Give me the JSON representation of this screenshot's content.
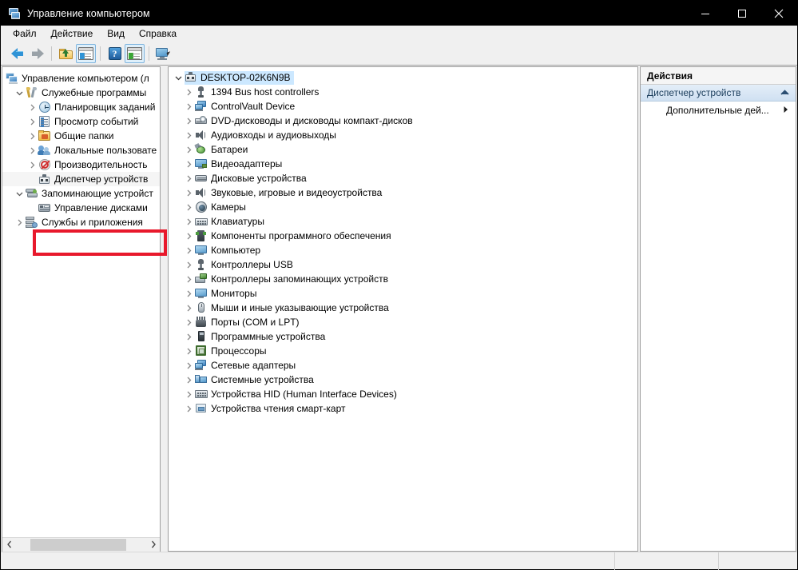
{
  "window": {
    "title": "Управление компьютером",
    "icon": "computer-management-icon",
    "minimize_label": "—",
    "maximize_label": "▢",
    "close_label": "✕"
  },
  "menubar": {
    "items": [
      {
        "label": "Файл",
        "name": "menu-file"
      },
      {
        "label": "Действие",
        "name": "menu-action"
      },
      {
        "label": "Вид",
        "name": "menu-view"
      },
      {
        "label": "Справка",
        "name": "menu-help"
      }
    ]
  },
  "toolbar": {
    "buttons": [
      {
        "name": "back-button",
        "icon": "back-arrow-icon"
      },
      {
        "name": "forward-button",
        "icon": "forward-arrow-icon"
      },
      {
        "name": "up-one-level-button",
        "icon": "folder-up-icon"
      },
      {
        "name": "show-hide-console-tree-button",
        "icon": "tree-panel-icon"
      },
      {
        "name": "help-button",
        "icon": "help-icon"
      },
      {
        "name": "show-hide-action-pane-button",
        "icon": "action-pane-icon"
      },
      {
        "name": "properties-button",
        "icon": "console-display-icon"
      }
    ]
  },
  "tree": {
    "items": [
      {
        "label": "Управление компьютером (л",
        "icon": "console-icon",
        "indent": 0,
        "chevron": "none",
        "name": "tree-item-computer-management"
      },
      {
        "label": "Служебные программы",
        "icon": "tools-icon",
        "indent": 1,
        "chevron": "expanded",
        "name": "tree-item-system-tools"
      },
      {
        "label": "Планировщик заданий",
        "icon": "clock-icon",
        "indent": 2,
        "chevron": "collapsed",
        "name": "tree-item-task-scheduler"
      },
      {
        "label": "Просмотр событий",
        "icon": "event-viewer-icon",
        "indent": 2,
        "chevron": "collapsed",
        "name": "tree-item-event-viewer"
      },
      {
        "label": "Общие папки",
        "icon": "shared-folders-icon",
        "indent": 2,
        "chevron": "collapsed",
        "name": "tree-item-shared-folders"
      },
      {
        "label": "Локальные пользовате",
        "icon": "users-icon",
        "indent": 2,
        "chevron": "collapsed",
        "name": "tree-item-local-users-groups"
      },
      {
        "label": "Производительность",
        "icon": "performance-icon",
        "indent": 2,
        "chevron": "collapsed",
        "name": "tree-item-performance"
      },
      {
        "label": "Диспетчер устройств",
        "icon": "device-manager-icon",
        "indent": 2,
        "chevron": "none",
        "name": "tree-item-device-manager",
        "selected": true
      },
      {
        "label": "Запоминающие устройст",
        "icon": "storage-icon",
        "indent": 1,
        "chevron": "expanded",
        "name": "tree-item-storage"
      },
      {
        "label": "Управление дисками",
        "icon": "disk-management-icon",
        "indent": 2,
        "chevron": "none",
        "name": "tree-item-disk-management"
      },
      {
        "label": "Службы и приложения",
        "icon": "services-icon",
        "indent": 1,
        "chevron": "collapsed",
        "name": "tree-item-services-applications"
      }
    ],
    "hscroll": {
      "left_arrow": "‹",
      "right_arrow": "›"
    }
  },
  "device_list": {
    "root": {
      "label": "DESKTOP-02K6N9B",
      "icon": "computer-node-icon",
      "chevron": "expanded",
      "selected": true
    },
    "items": [
      {
        "label": "1394 Bus host controllers",
        "icon": "usb-icon"
      },
      {
        "label": "ControlVault Device",
        "icon": "network-device-icon"
      },
      {
        "label": "DVD-дисководы и дисководы компакт-дисков",
        "icon": "dvd-drive-icon"
      },
      {
        "label": "Аудиовходы и аудиовыходы",
        "icon": "speaker-icon"
      },
      {
        "label": "Батареи",
        "icon": "battery-icon"
      },
      {
        "label": "Видеоадаптеры",
        "icon": "video-adapter-icon"
      },
      {
        "label": "Дисковые устройства",
        "icon": "hard-disk-icon"
      },
      {
        "label": "Звуковые, игровые и видеоустройства",
        "icon": "speaker-icon"
      },
      {
        "label": "Камеры",
        "icon": "camera-icon"
      },
      {
        "label": "Клавиатуры",
        "icon": "keyboard-icon"
      },
      {
        "label": "Компоненты программного обеспечения",
        "icon": "software-component-icon"
      },
      {
        "label": "Компьютер",
        "icon": "monitor-icon"
      },
      {
        "label": "Контроллеры USB",
        "icon": "usb-icon"
      },
      {
        "label": "Контроллеры запоминающих устройств",
        "icon": "storage-controller-icon"
      },
      {
        "label": "Мониторы",
        "icon": "monitor-icon"
      },
      {
        "label": "Мыши и иные указывающие устройства",
        "icon": "mouse-icon"
      },
      {
        "label": "Порты (COM и LPT)",
        "icon": "port-icon"
      },
      {
        "label": "Программные устройства",
        "icon": "software-device-icon"
      },
      {
        "label": "Процессоры",
        "icon": "cpu-icon"
      },
      {
        "label": "Сетевые адаптеры",
        "icon": "network-device-icon"
      },
      {
        "label": "Системные устройства",
        "icon": "system-device-icon"
      },
      {
        "label": "Устройства HID (Human Interface Devices)",
        "icon": "hid-icon"
      },
      {
        "label": "Устройства чтения смарт-карт",
        "icon": "smartcard-reader-icon"
      }
    ]
  },
  "actions": {
    "title": "Действия",
    "section": {
      "label": "Диспетчер устройств",
      "collapse_icon": "chevron-up-icon"
    },
    "items": [
      {
        "label": "Дополнительные дей...",
        "submenu_icon": "chevron-right-icon",
        "name": "action-more-actions"
      }
    ]
  },
  "statusbar": {
    "cells": [
      "",
      "",
      ""
    ]
  },
  "annotation": {
    "highlight_color": "#e8192c",
    "target": "Диспетчер устройств"
  },
  "colors": {
    "selection": "#cce8ff",
    "titlebar_bg": "#000000",
    "window_bg": "#f0f0f0",
    "accent_blue": "#2f93d6"
  }
}
